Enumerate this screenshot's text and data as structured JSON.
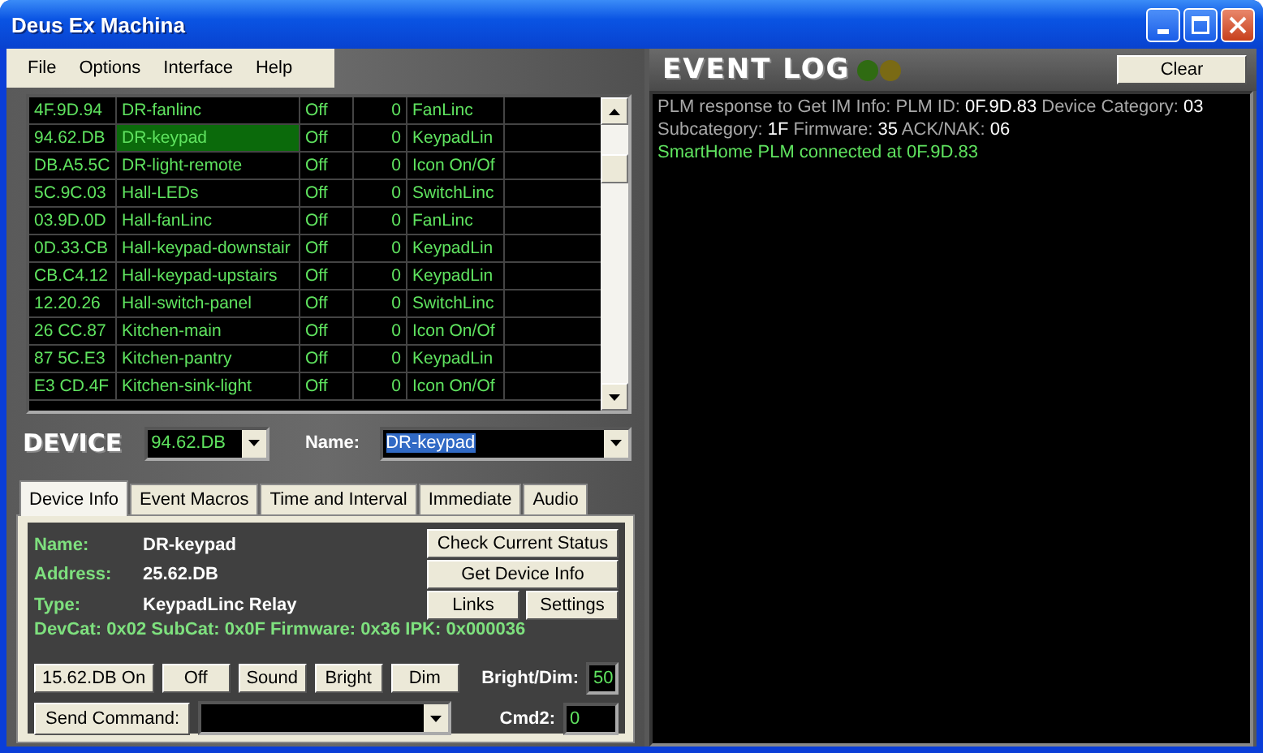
{
  "window": {
    "title": "Deus Ex Machina"
  },
  "menu": [
    "File",
    "Options",
    "Interface",
    "Help"
  ],
  "devices": [
    {
      "address": "4F.9D.94",
      "name": "DR-fanlinc",
      "state": "Off",
      "level": "0",
      "type": "FanLinc",
      "selected": false
    },
    {
      "address": "94.62.DB",
      "name": "DR-keypad",
      "state": "Off",
      "level": "0",
      "type": "KeypadLin",
      "selected": true
    },
    {
      "address": "DB.A5.5C",
      "name": "DR-light-remote",
      "state": "Off",
      "level": "0",
      "type": "Icon On/Of",
      "selected": false
    },
    {
      "address": "5C.9C.03",
      "name": "Hall-LEDs",
      "state": "Off",
      "level": "0",
      "type": "SwitchLinc",
      "selected": false
    },
    {
      "address": "03.9D.0D",
      "name": "Hall-fanLinc",
      "state": "Off",
      "level": "0",
      "type": "FanLinc",
      "selected": false
    },
    {
      "address": "0D.33.CB",
      "name": "Hall-keypad-downstair",
      "state": "Off",
      "level": "0",
      "type": "KeypadLin",
      "selected": false
    },
    {
      "address": "CB.C4.12",
      "name": "Hall-keypad-upstairs",
      "state": "Off",
      "level": "0",
      "type": "KeypadLin",
      "selected": false
    },
    {
      "address": "12.20.26",
      "name": "Hall-switch-panel",
      "state": "Off",
      "level": "0",
      "type": "SwitchLinc",
      "selected": false
    },
    {
      "address": "26 CC.87",
      "name": "Kitchen-main",
      "state": "Off",
      "level": "0",
      "type": "Icon On/Of",
      "selected": false
    },
    {
      "address": "87 5C.E3",
      "name": "Kitchen-pantry",
      "state": "Off",
      "level": "0",
      "type": "KeypadLin",
      "selected": false
    },
    {
      "address": "E3 CD.4F",
      "name": "Kitchen-sink-light",
      "state": "Off",
      "level": "0",
      "type": "Icon On/Of",
      "selected": false
    }
  ],
  "device_bar": {
    "logo": "DEVICE",
    "address": "94.62.DB",
    "name_label": "Name:",
    "name": "DR-keypad"
  },
  "tabs": [
    {
      "label": "Device Info",
      "selected": true
    },
    {
      "label": "Event Macros",
      "selected": false
    },
    {
      "label": "Time and Interval",
      "selected": false
    },
    {
      "label": "Immediate",
      "selected": false
    },
    {
      "label": "Audio",
      "selected": false
    }
  ],
  "device_info": {
    "fields": [
      {
        "label": "Name:",
        "value": "DR-keypad"
      },
      {
        "label": "Address:",
        "value": "25.62.DB"
      },
      {
        "label": "Type:",
        "value": "KeypadLinc Relay"
      }
    ],
    "details": "DevCat: 0x02  SubCat: 0x0F  Firmware: 0x36  IPK: 0x000036",
    "side_buttons": [
      "Check Current Status",
      "Get Device Info",
      "Links",
      "Settings"
    ],
    "command_buttons": [
      "15.62.DB On",
      "Off",
      "Sound",
      "Bright",
      "Dim"
    ],
    "bright_dim_label": "Bright/Dim:",
    "bright_dim": "50",
    "send_button": "Send Command:",
    "cmd2_label": "Cmd2:",
    "cmd2": "0"
  },
  "event_log": {
    "logo": "EVENT LOG",
    "indicators": [
      {
        "color": "#2f6b12"
      },
      {
        "color": "#7a6a14"
      }
    ],
    "clear_button": "Clear",
    "lines": [
      {
        "kind": "info",
        "parts": [
          {
            "text": "PLM response to Get IM Info: PLM ID: ",
            "kind": "label"
          },
          {
            "text": "0F.9D.83",
            "kind": "value"
          },
          {
            "text": " Device Category: ",
            "kind": "label"
          },
          {
            "text": "03",
            "kind": "value"
          },
          {
            "text": " Subcategory: ",
            "kind": "label"
          },
          {
            "text": "1F",
            "kind": "value"
          },
          {
            "text": " Firmware: ",
            "kind": "label"
          },
          {
            "text": "35",
            "kind": "value"
          },
          {
            "text": " ACK/NAK: ",
            "kind": "label"
          },
          {
            "text": "06",
            "kind": "value"
          }
        ]
      },
      {
        "kind": "success",
        "parts": [
          {
            "text": "SmartHome PLM connected at 0F.9D.83",
            "kind": "label"
          }
        ]
      }
    ]
  }
}
